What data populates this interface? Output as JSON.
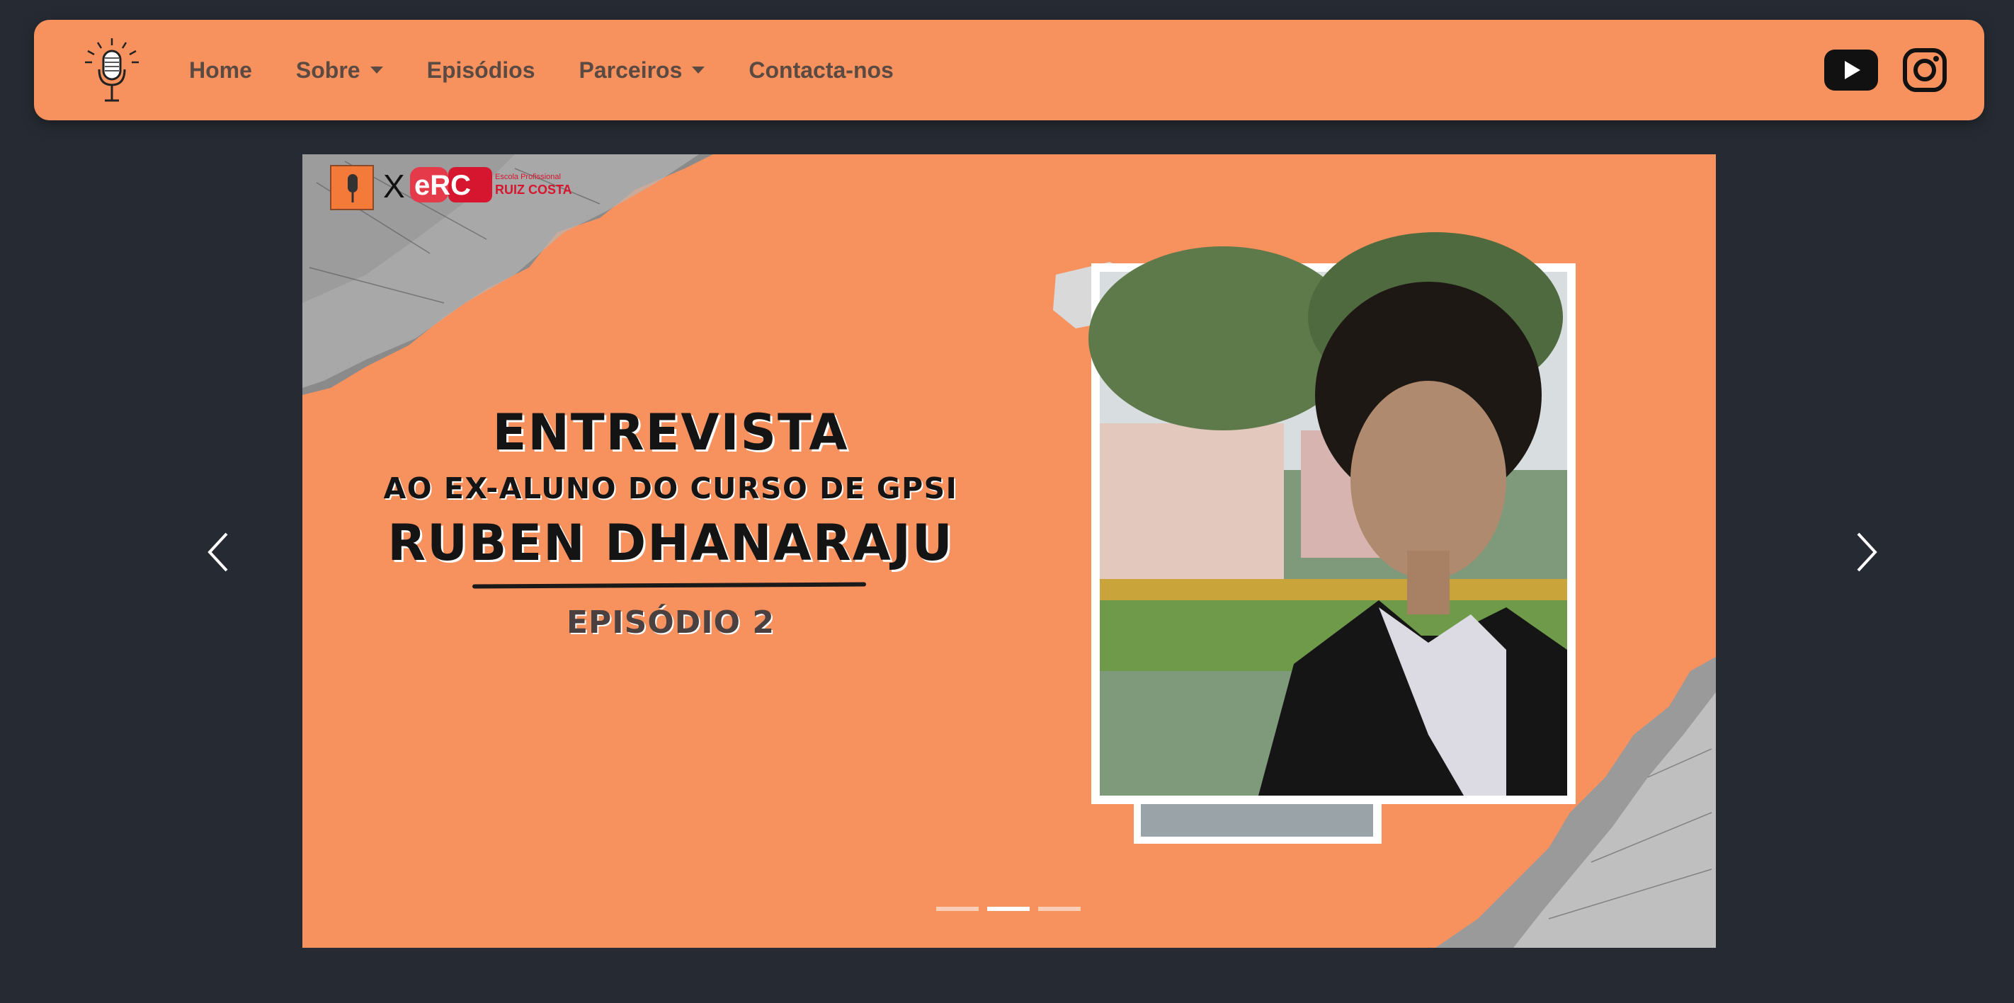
{
  "navbar": {
    "logo_icon": "podcast-microphone-icon",
    "links": [
      {
        "label": "Home",
        "dropdown": false
      },
      {
        "label": "Sobre",
        "dropdown": true
      },
      {
        "label": "Episódios",
        "dropdown": false
      },
      {
        "label": "Parceiros",
        "dropdown": true
      },
      {
        "label": "Contacta-nos",
        "dropdown": false
      }
    ],
    "social": [
      "youtube-icon",
      "instagram-icon"
    ]
  },
  "carousel": {
    "slide": {
      "partner_x": "X",
      "partner_logo_text": "eRC",
      "partner_small": "Escola Profissional",
      "partner_name": "RUIZ COSTA",
      "title": "ENTREVISTA",
      "subtitle": "AO EX-ALUNO DO CURSO DE GPSI",
      "name": "RUBEN DHANARAJU",
      "episode": "EPISÓDIO 2"
    },
    "indicators": 3,
    "active_indicator": 1,
    "controls": [
      "previous",
      "next"
    ]
  },
  "colors": {
    "background": "#262b33",
    "accent": "#f7925f",
    "nav_text": "#5a4a42"
  }
}
